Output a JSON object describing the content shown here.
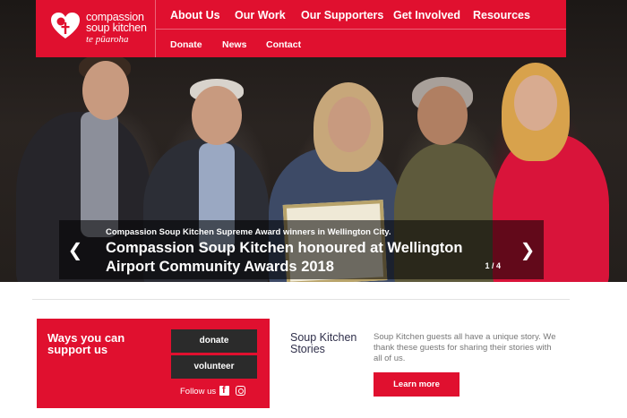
{
  "brand": {
    "line1": "compassion",
    "line2": "soup kitchen",
    "line3": "te pūaroha",
    "logo_icon": "heart-cross-logo",
    "color": "#e0102f"
  },
  "nav": {
    "primary": [
      "About Us",
      "Our Work",
      "Our Supporters",
      "Get Involved",
      "Resources"
    ],
    "secondary": [
      "Donate",
      "News",
      "Contact"
    ]
  },
  "slide": {
    "subtitle": "Compassion Soup Kitchen Supreme Award winners in Wellington City.",
    "title": "Compassion Soup Kitchen honoured at Wellington Airport Community Awards 2018",
    "pager": "1 / 4",
    "prev_icon": "chevron-left",
    "next_icon": "chevron-right"
  },
  "support": {
    "heading": "Ways you can support us",
    "donate": "donate",
    "volunteer": "volunteer",
    "follow": "Follow us",
    "social_icons": [
      "facebook",
      "instagram"
    ]
  },
  "stories": {
    "title": "Soup Kitchen Stories",
    "text": "Soup Kitchen guests all have a unique story. We thank these guests for sharing their stories with all of us.",
    "button": "Learn more"
  }
}
